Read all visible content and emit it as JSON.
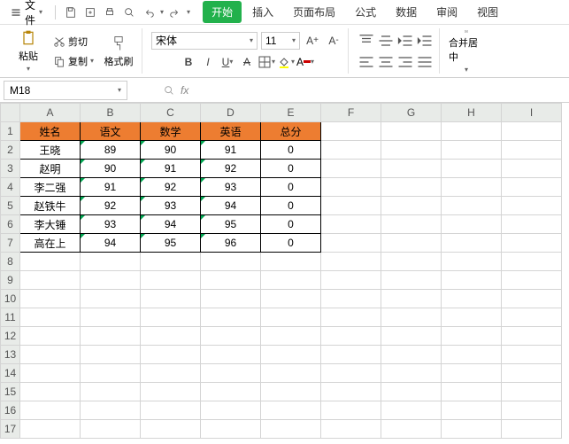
{
  "menu": {
    "file": "文件",
    "tabs": [
      "开始",
      "插入",
      "页面布局",
      "公式",
      "数据",
      "审阅",
      "视图"
    ]
  },
  "ribbon": {
    "paste": "粘贴",
    "cut": "剪切",
    "copy": "复制",
    "format_painter": "格式刷",
    "font_name": "宋体",
    "font_size": "11",
    "merge_center": "合并居中"
  },
  "namebox": {
    "ref": "M18"
  },
  "columns": [
    "A",
    "B",
    "C",
    "D",
    "E",
    "F",
    "G",
    "H",
    "I"
  ],
  "row_count": 17,
  "chart_data": {
    "type": "table",
    "headers": [
      "姓名",
      "语文",
      "数学",
      "英语",
      "总分"
    ],
    "rows": [
      [
        "王晓",
        89,
        90,
        91,
        0
      ],
      [
        "赵明",
        90,
        91,
        92,
        0
      ],
      [
        "李二强",
        91,
        92,
        93,
        0
      ],
      [
        "赵铁牛",
        92,
        93,
        94,
        0
      ],
      [
        "李大锤",
        93,
        94,
        95,
        0
      ],
      [
        "高在上",
        94,
        95,
        96,
        0
      ]
    ]
  }
}
